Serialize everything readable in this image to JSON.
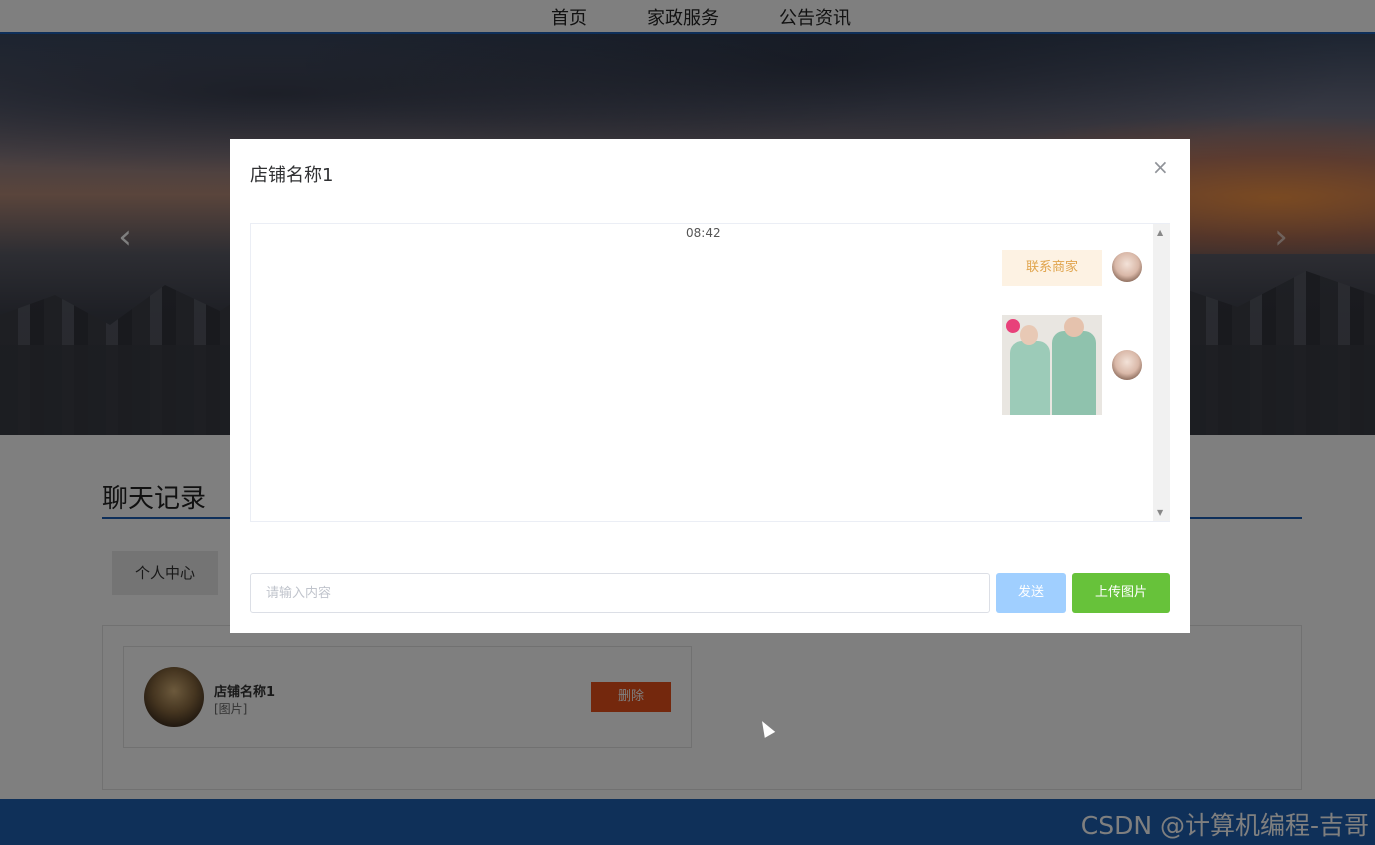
{
  "nav": {
    "home": "首页",
    "service": "家政服务",
    "news": "公告资讯"
  },
  "banner": {
    "prev": "‹",
    "next": "›"
  },
  "page": {
    "title": "聊天记录",
    "tab_personal": "个人中心"
  },
  "chat_list": [
    {
      "name": "店铺名称1",
      "last_message": "[图片]",
      "delete_label": "删除"
    }
  ],
  "dialog": {
    "title": "店铺名称1",
    "close": "×",
    "time": "08:42",
    "messages": [
      {
        "type": "text",
        "text": "联系商家",
        "side": "right"
      },
      {
        "type": "image",
        "side": "right"
      }
    ],
    "input_placeholder": "请输入内容",
    "send_label": "发送",
    "upload_label": "上传图片"
  },
  "watermark": "CSDN @计算机编程-吉哥"
}
